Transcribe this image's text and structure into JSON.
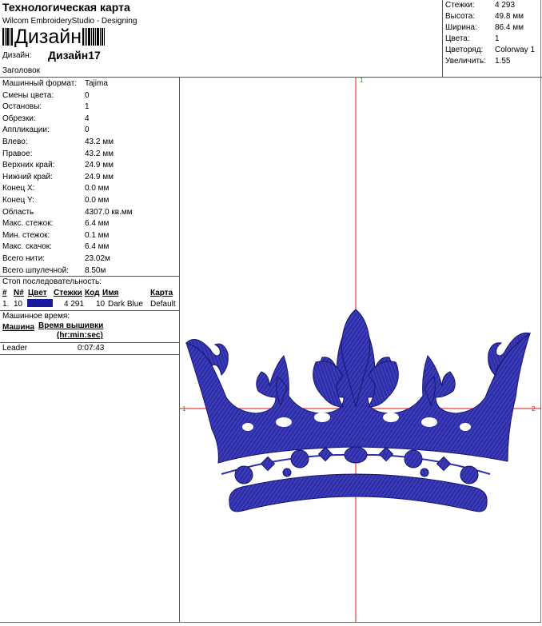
{
  "header": {
    "title": "Технологическая карта",
    "subtitle": "Wilcom EmbroideryStudio - Designing",
    "barcode_text": "Дизайн",
    "design_label": "Дизайн:",
    "design_value": "Дизайн17",
    "heading_label": "Заголовок"
  },
  "stats": [
    {
      "label": "Стежки:",
      "value": "4 293"
    },
    {
      "label": "Высота:",
      "value": "49.8 мм"
    },
    {
      "label": "Ширина:",
      "value": "86.4 мм"
    },
    {
      "label": "Цвета:",
      "value": "1"
    },
    {
      "label": "Цветоряд:",
      "value": "Colorway 1"
    },
    {
      "label": "Увеличить:",
      "value": "1.55"
    }
  ],
  "machine_info": [
    {
      "label": "Машинный формат:",
      "value": "Tajima"
    },
    {
      "label": "Смены цвета:",
      "value": "0"
    },
    {
      "label": "Остановы:",
      "value": "1"
    },
    {
      "label": "Обрезки:",
      "value": "4"
    },
    {
      "label": "Аппликации:",
      "value": "0"
    },
    {
      "label": "Влево:",
      "value": "43.2 мм"
    },
    {
      "label": "Правое:",
      "value": "43.2 мм"
    },
    {
      "label": "Верхних край:",
      "value": "24.9 мм"
    },
    {
      "label": "Нижний край:",
      "value": "24.9 мм"
    },
    {
      "label": "Конец X:",
      "value": "0.0 мм"
    },
    {
      "label": "Конец Y:",
      "value": "0.0 мм"
    },
    {
      "label": "Область",
      "value": "4307.0 кв.мм"
    },
    {
      "label": "Макс. стежок:",
      "value": "6.4 мм"
    },
    {
      "label": "Мин. стежок:",
      "value": "0.1 мм"
    },
    {
      "label": "Макс. скачок:",
      "value": "6.4 мм"
    },
    {
      "label": "Всего нити:",
      "value": "23.02м"
    },
    {
      "label": "Всего шпулечной:",
      "value": "8.50м"
    }
  ],
  "stop_sequence": {
    "title": "Стоп последовательность:",
    "headers": [
      "#",
      "N#",
      "Цвет",
      "Стежки",
      "Код",
      "Имя",
      "Карта"
    ],
    "rows": [
      {
        "num": "1.",
        "n": "10",
        "color": "#1a1aa0",
        "stitches": "4 291",
        "code": "10",
        "name": "Dark Blue",
        "card": "Default"
      }
    ]
  },
  "machine_time": {
    "title": "Машинное время:",
    "col_machine": "Машина",
    "col_time": "Время вышивки",
    "col_time_unit": "(hr:min:sec)",
    "rows": [
      {
        "machine": "Leader",
        "time": "0:07:43"
      }
    ]
  },
  "canvas": {
    "marker_top": "1",
    "marker_left": "1",
    "marker_right": "2",
    "crosshair_color": "#e01010",
    "thread_color": "#2e2ea8",
    "thread_highlight": "#5a5ad6",
    "thread_shadow": "#16166e"
  }
}
